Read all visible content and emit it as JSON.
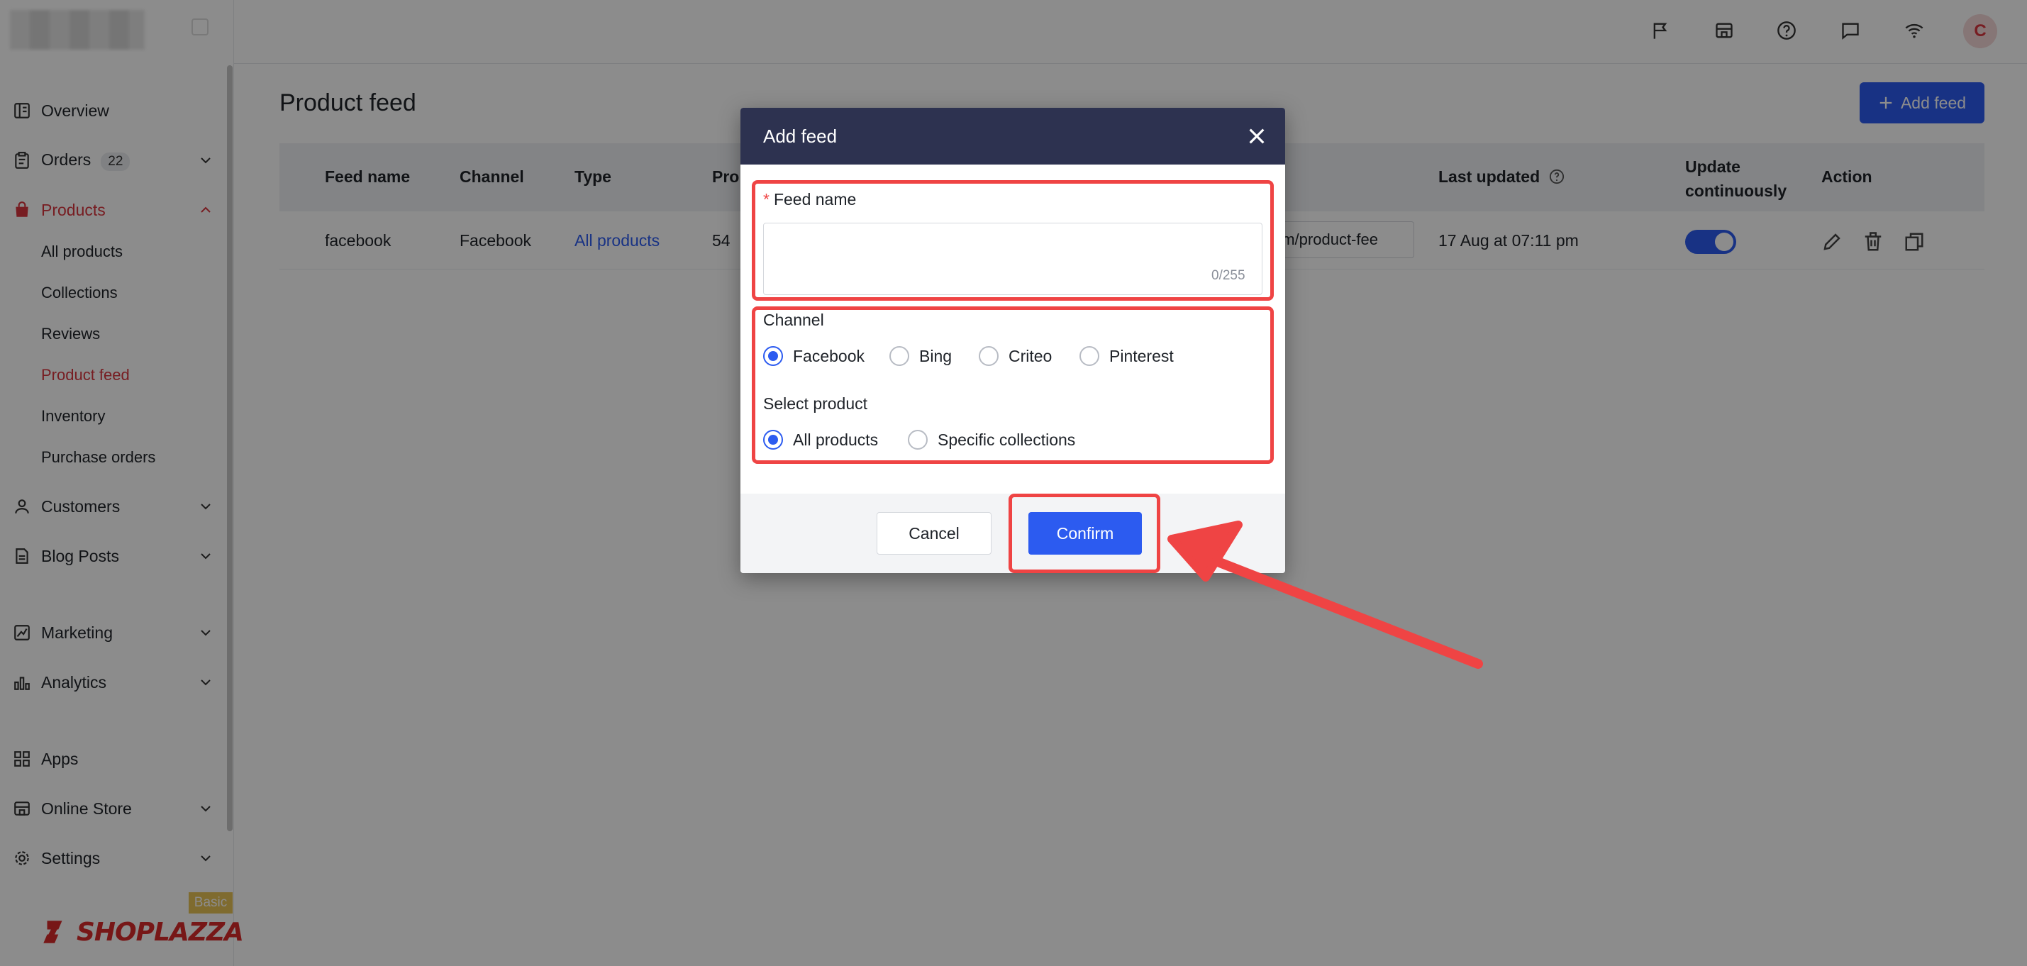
{
  "sidebar": {
    "items": [
      {
        "label": "Overview"
      },
      {
        "label": "Orders",
        "badge": "22"
      },
      {
        "label": "Products"
      },
      {
        "label": "Customers"
      },
      {
        "label": "Blog Posts"
      },
      {
        "label": "Marketing"
      },
      {
        "label": "Analytics"
      },
      {
        "label": "Apps"
      },
      {
        "label": "Online Store"
      },
      {
        "label": "Settings"
      }
    ],
    "product_sub": [
      {
        "label": "All products"
      },
      {
        "label": "Collections"
      },
      {
        "label": "Reviews"
      },
      {
        "label": "Product feed"
      },
      {
        "label": "Inventory"
      },
      {
        "label": "Purchase orders"
      }
    ],
    "plan_badge": "Basic",
    "brand": "SHOPLAZZA"
  },
  "topbar": {
    "icons": [
      "flag-icon",
      "store-icon",
      "help-icon",
      "chat-icon",
      "wifi-icon"
    ],
    "avatar_initial": "C"
  },
  "main": {
    "title": "Product feed",
    "add_button": "Add feed",
    "table": {
      "headers": {
        "feed_name": "Feed name",
        "channel": "Channel",
        "type": "Type",
        "products": "Pro",
        "last_updated": "Last updated",
        "update_continuously": "Update continuously",
        "action": "Action"
      },
      "rows": [
        {
          "feed_name": "facebook",
          "channel": "Facebook",
          "type": "All products",
          "products": "54",
          "url": "om/product-fee",
          "last_updated": "17 Aug at 07:11 pm",
          "update_continuously": true
        }
      ]
    }
  },
  "modal": {
    "title": "Add feed",
    "feed_name_label": "Feed name",
    "feed_name_value": "",
    "feed_name_counter": "0/255",
    "channel_label": "Channel",
    "channels": [
      "Facebook",
      "Bing",
      "Criteo",
      "Pinterest"
    ],
    "channel_selected": "Facebook",
    "select_product_label": "Select product",
    "product_options": [
      "All products",
      "Specific collections"
    ],
    "product_selected": "All products",
    "cancel_label": "Cancel",
    "confirm_label": "Confirm"
  },
  "colors": {
    "accent": "#2c5bf0",
    "active_nav": "#d9363e",
    "modal_header": "#2d3250",
    "highlight": "#ef4444"
  }
}
